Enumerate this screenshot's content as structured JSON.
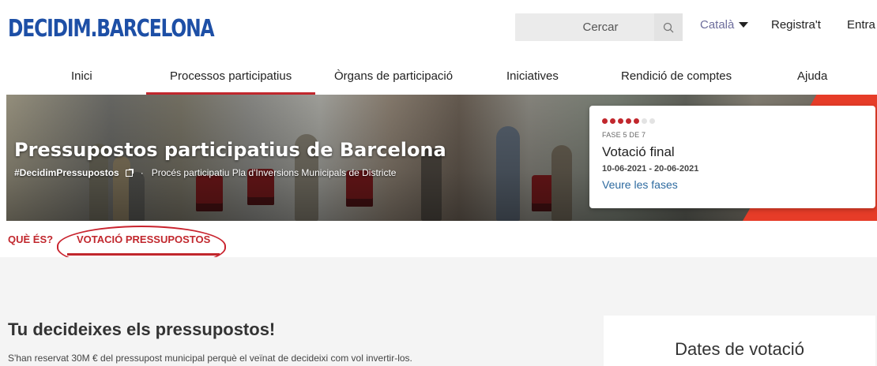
{
  "header": {
    "logo": "DECIDIM.BARCELONA",
    "search_placeholder": "Cercar",
    "language": "Català",
    "register": "Registra't",
    "login": "Entra"
  },
  "nav": {
    "items": [
      {
        "label": "Inici"
      },
      {
        "label": "Processos participatius",
        "active": true
      },
      {
        "label": "Òrgans de participació"
      },
      {
        "label": "Iniciatives"
      },
      {
        "label": "Rendició de comptes"
      },
      {
        "label": "Ajuda"
      }
    ]
  },
  "hero": {
    "title": "Pressupostos participatius de Barcelona",
    "hashtag": "#DecidimPressupostos",
    "separator": "·",
    "subtitle": "Procés participatiu Pla d'Inversions Municipals de Districte"
  },
  "phase": {
    "label": "FASE 5 DE 7",
    "current": 5,
    "total": 7,
    "name": "Votació final",
    "dates": "10-06-2021 - 20-06-2021",
    "link": "Veure les fases"
  },
  "subtabs": [
    {
      "label": "QUÈ ÉS?"
    },
    {
      "label": "VOTACIÓ PRESSUPOSTOS",
      "active": true
    }
  ],
  "content": {
    "title": "Tu decideixes els pressupostos!",
    "text": "S'han reservat 30M € del pressupost municipal perquè el veïnat de decideixi com vol invertir-los.",
    "side_title": "Dates de votació"
  },
  "colors": {
    "brand_blue": "#1d4fa6",
    "accent_red": "#c1272d",
    "link_blue": "#2d6a9f"
  }
}
